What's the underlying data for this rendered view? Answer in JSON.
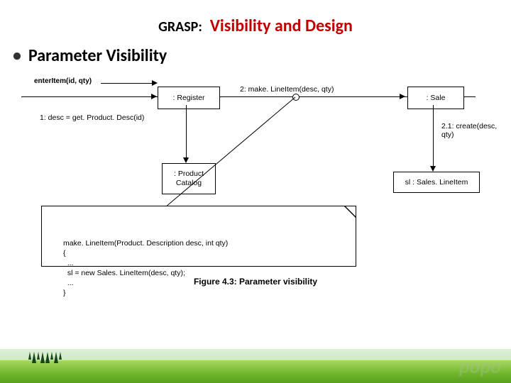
{
  "title": {
    "prefix": "GRASP:",
    "main": "Visibility and Design"
  },
  "bullet": "Parameter Visibility",
  "diagram": {
    "label_enter": "enterItem(id, qty)",
    "label_make": "2: make. LineItem(desc, qty)",
    "label_desc": "1: desc = get. Product. Desc(id)",
    "label_create": "2.1: create(desc, qty)",
    "obj_register": ": Register",
    "obj_sale": ": Sale",
    "obj_catalog": ": Product\nCatalog",
    "obj_sli": "sl : Sales. LineItem",
    "code": "make. LineItem(Product. Description desc, int qty)\n{\n  ...\n  sl = new Sales. LineItem(desc, qty);\n  ...\n}"
  },
  "caption": "Figure 4.3: Parameter visibility",
  "watermark": "popo",
  "chart_data": {
    "type": "collaboration-diagram",
    "lifelines": [
      ": Register",
      ": Sale",
      ": Product Catalog",
      "sl : Sales.LineItem"
    ],
    "messages": [
      {
        "seq": "",
        "text": "enterItem(id, qty)",
        "to": ": Register"
      },
      {
        "seq": "1",
        "text": "desc = get.Product.Desc(id)",
        "from": ": Register",
        "to": ": Product Catalog"
      },
      {
        "seq": "2",
        "text": "make.LineItem(desc, qty)",
        "from": ": Register",
        "to": ": Sale"
      },
      {
        "seq": "2.1",
        "text": "create(desc, qty)",
        "from": ": Sale",
        "to": "sl : Sales.LineItem"
      }
    ],
    "note": "make.LineItem(Product.Description desc, int qty){ ... sl = new Sales.LineItem(desc, qty); ... }",
    "caption": "Figure 4.3: Parameter visibility",
    "title": "GRASP: Visibility and Design — Parameter Visibility"
  }
}
